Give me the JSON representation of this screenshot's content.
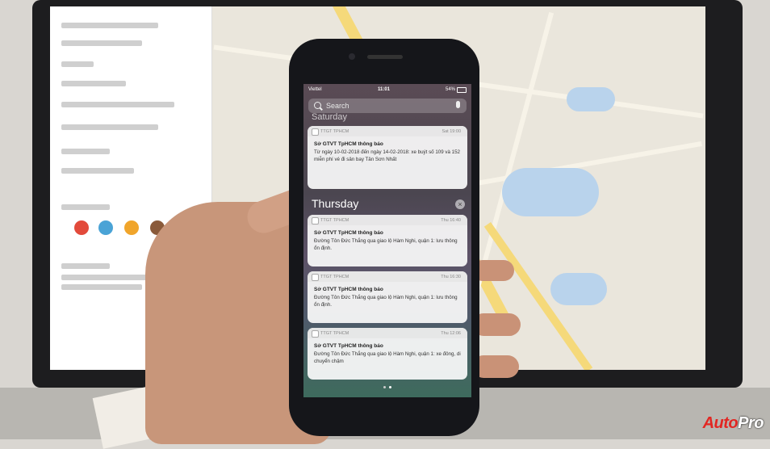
{
  "phone": {
    "status": {
      "carrier": "Viettel",
      "time": "11:01",
      "battery": "54%"
    },
    "search": {
      "placeholder": "Search"
    },
    "sections": [
      {
        "header": "Saturday",
        "notifications": [
          {
            "app": "TTGT TPHCM",
            "time": "Sat 19:00",
            "title": "Sở GTVT TpHCM thông báo",
            "body": "Từ ngày 10-02-2018 đến ngày 14-02-2018: xe buýt số 109 và 152 miễn phí vé đi sân bay Tân Sơn Nhất"
          }
        ]
      },
      {
        "header": "Thursday",
        "notifications": [
          {
            "app": "TTGT TPHCM",
            "time": "Thu 16:40",
            "title": "Sở GTVT TpHCM thông báo",
            "body": "Đường Tôn Đức Thắng qua giao lộ Hàm Nghi, quận 1: lưu thông ổn định."
          },
          {
            "app": "TTGT TPHCM",
            "time": "Thu 16:30",
            "title": "Sở GTVT TpHCM thông báo",
            "body": "Đường Tôn Đức Thắng qua giao lộ Hàm Nghi, quận 1: lưu thông ổn định."
          },
          {
            "app": "TTGT TPHCM",
            "time": "Thu 12:06",
            "title": "Sở GTVT TpHCM thông báo",
            "body": "Đường Tôn Đức Thắng qua giao lộ Hàm Nghi, quận 1: xe đông, di chuyển chậm"
          }
        ]
      }
    ]
  },
  "logo": {
    "part1": "Auto",
    "part2": "Pro"
  },
  "colors": {
    "logo_red": "#e22622",
    "map_background": "#eae6dc",
    "water": "#b9d3ec",
    "highway": "#f5d97a"
  },
  "icons": [
    "search-icon",
    "mic-icon",
    "clear-icon",
    "app-icon"
  ]
}
